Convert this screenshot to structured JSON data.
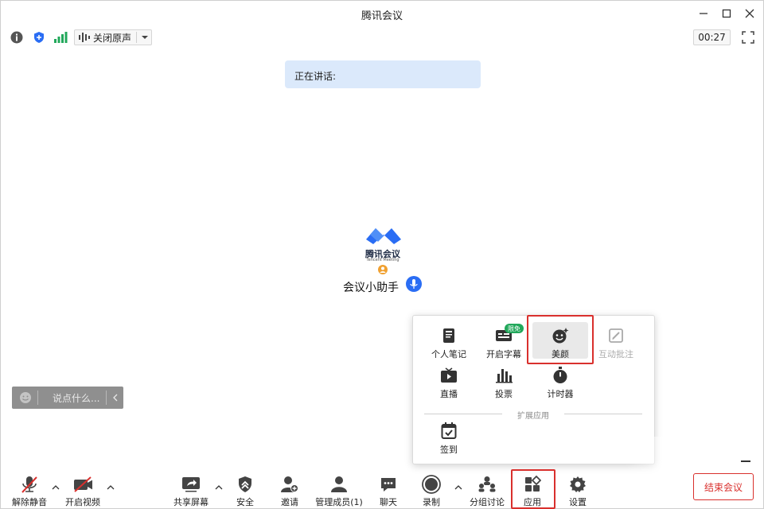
{
  "window": {
    "title": "腾讯会议",
    "controls": [
      "minimize-icon",
      "maximize-icon",
      "close-icon"
    ]
  },
  "infobar": {
    "audio_label": "关闭原声",
    "timer": "00:27",
    "icons": [
      "info-icon",
      "shield-icon",
      "signal-icon",
      "fullscreen-icon"
    ]
  },
  "speaking": {
    "label": "正在讲话:"
  },
  "participant": {
    "logo_name": "腾讯会议",
    "logo_sub": "Tencent Meeting",
    "name": "会议小助手"
  },
  "chat": {
    "placeholder": "说点什么..."
  },
  "apps_panel": {
    "items": [
      {
        "label": "个人笔记",
        "icon": "notebook-icon",
        "enabled": true
      },
      {
        "label": "开启字幕",
        "icon": "captions-icon",
        "enabled": true
      },
      {
        "label": "美颜",
        "icon": "beauty-icon",
        "enabled": true
      },
      {
        "label": "互动批注",
        "icon": "annotate-icon",
        "enabled": false
      },
      {
        "label": "直播",
        "icon": "live-icon",
        "enabled": true
      },
      {
        "label": "投票",
        "icon": "vote-icon",
        "enabled": true
      },
      {
        "label": "计时器",
        "icon": "timer-icon",
        "enabled": true
      }
    ],
    "free_badge": "限免",
    "section_label": "扩展应用",
    "extensions": [
      {
        "label": "签到",
        "icon": "checkin-icon",
        "enabled": true
      }
    ]
  },
  "toolbar": {
    "buttons": [
      {
        "label": "解除静音",
        "icon": "mic-muted-icon"
      },
      {
        "label": "开启视频",
        "icon": "camera-off-icon"
      },
      {
        "label": "共享屏幕",
        "icon": "share-screen-icon"
      },
      {
        "label": "安全",
        "icon": "security-icon"
      },
      {
        "label": "邀请",
        "icon": "invite-icon"
      },
      {
        "label": "管理成员(1)",
        "icon": "members-icon"
      },
      {
        "label": "聊天",
        "icon": "chat-icon"
      },
      {
        "label": "录制",
        "icon": "record-icon"
      },
      {
        "label": "分组讨论",
        "icon": "breakout-icon"
      },
      {
        "label": "应用",
        "icon": "apps-icon"
      },
      {
        "label": "设置",
        "icon": "settings-icon"
      }
    ],
    "leave_label": "结束会议"
  },
  "colors": {
    "accent": "#2a6df4",
    "highlight": "#d9302d",
    "banner": "#dbe9fb",
    "badge": "#22a85b"
  }
}
